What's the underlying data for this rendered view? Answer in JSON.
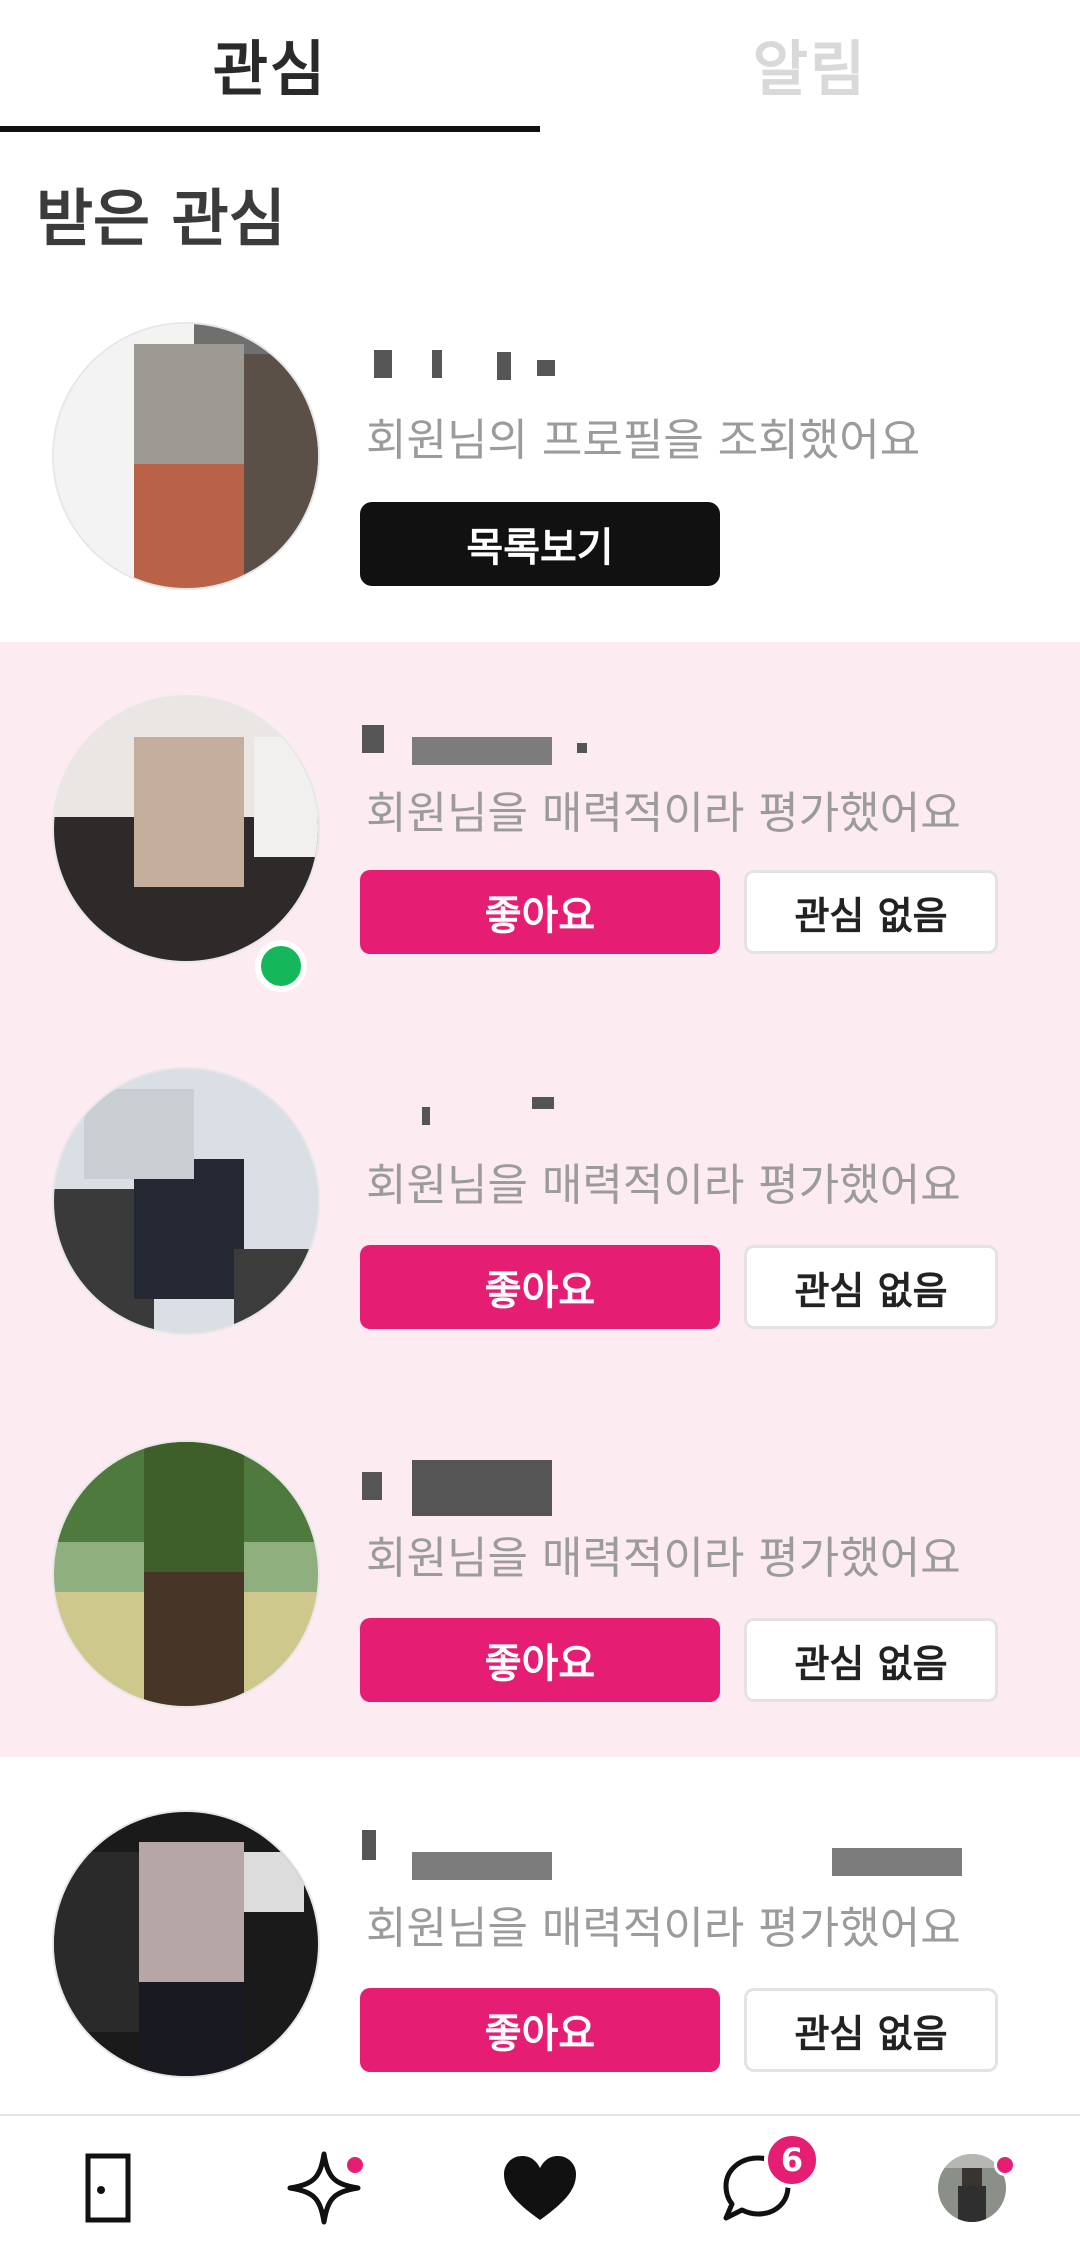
{
  "tabs": [
    {
      "label": "관심",
      "active": true
    },
    {
      "label": "알림",
      "active": false
    }
  ],
  "section_title": "받은 관심",
  "cards": [
    {
      "message": "회원님의 프로필을 조회했어요",
      "button_label": "목록보기"
    },
    {
      "message": "회원님을 매력적이라 평가했어요",
      "like_label": "좋아요",
      "pass_label": "관심 없음",
      "online": true
    },
    {
      "message": "회원님을 매력적이라 평가했어요",
      "like_label": "좋아요",
      "pass_label": "관심 없음"
    },
    {
      "message": "회원님을 매력적이라 평가했어요",
      "like_label": "좋아요",
      "pass_label": "관심 없음"
    },
    {
      "message": "회원님을 매력적이라 평가했어요",
      "like_label": "좋아요",
      "pass_label": "관심 없음"
    }
  ],
  "bottom_nav": {
    "items": [
      {
        "icon": "door-icon"
      },
      {
        "icon": "sparkle-icon",
        "dot": true
      },
      {
        "icon": "heart-icon"
      },
      {
        "icon": "chat-icon",
        "badge": "6"
      },
      {
        "icon": "profile-avatar",
        "dot": true
      }
    ]
  },
  "colors": {
    "accent": "#e61e73",
    "highlight_bg": "#fcebf1",
    "online": "#14b85a"
  }
}
